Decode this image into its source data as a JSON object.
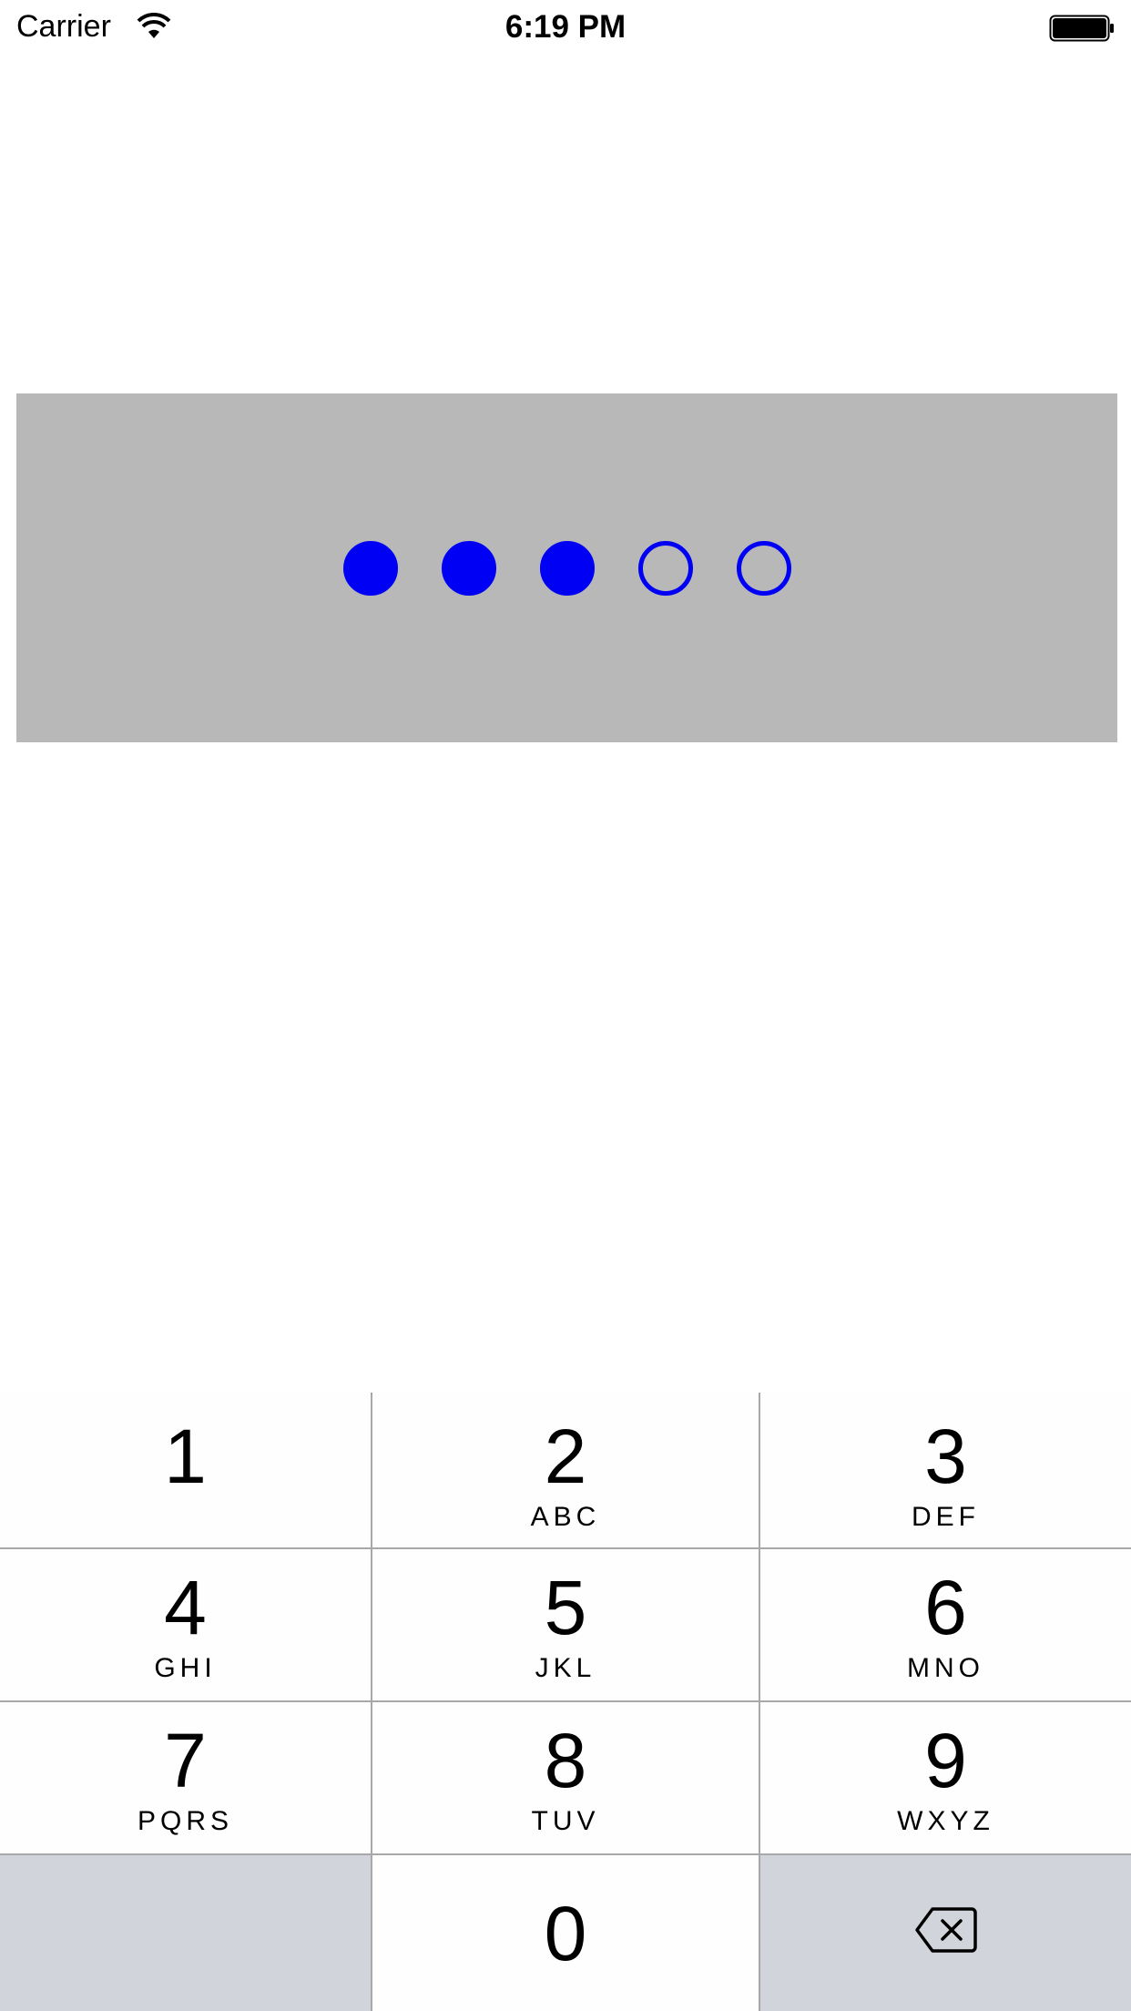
{
  "status_bar": {
    "carrier": "Carrier",
    "time": "6:19 PM",
    "icons": [
      "wifi-icon",
      "battery-icon"
    ]
  },
  "passcode": {
    "total_digits": 5,
    "entered_digits": 3,
    "dot_color": "#0000f5",
    "panel_color": "#b8b8b8"
  },
  "keypad": {
    "keys": [
      {
        "digit": "1",
        "letters": ""
      },
      {
        "digit": "2",
        "letters": "ABC"
      },
      {
        "digit": "3",
        "letters": "DEF"
      },
      {
        "digit": "4",
        "letters": "GHI"
      },
      {
        "digit": "5",
        "letters": "JKL"
      },
      {
        "digit": "6",
        "letters": "MNO"
      },
      {
        "digit": "7",
        "letters": "PQRS"
      },
      {
        "digit": "8",
        "letters": "TUV"
      },
      {
        "digit": "9",
        "letters": "WXYZ"
      },
      {
        "digit": "0",
        "letters": ""
      }
    ],
    "delete_icon": "backspace-icon",
    "dark_key_color": "#d1d4da"
  }
}
